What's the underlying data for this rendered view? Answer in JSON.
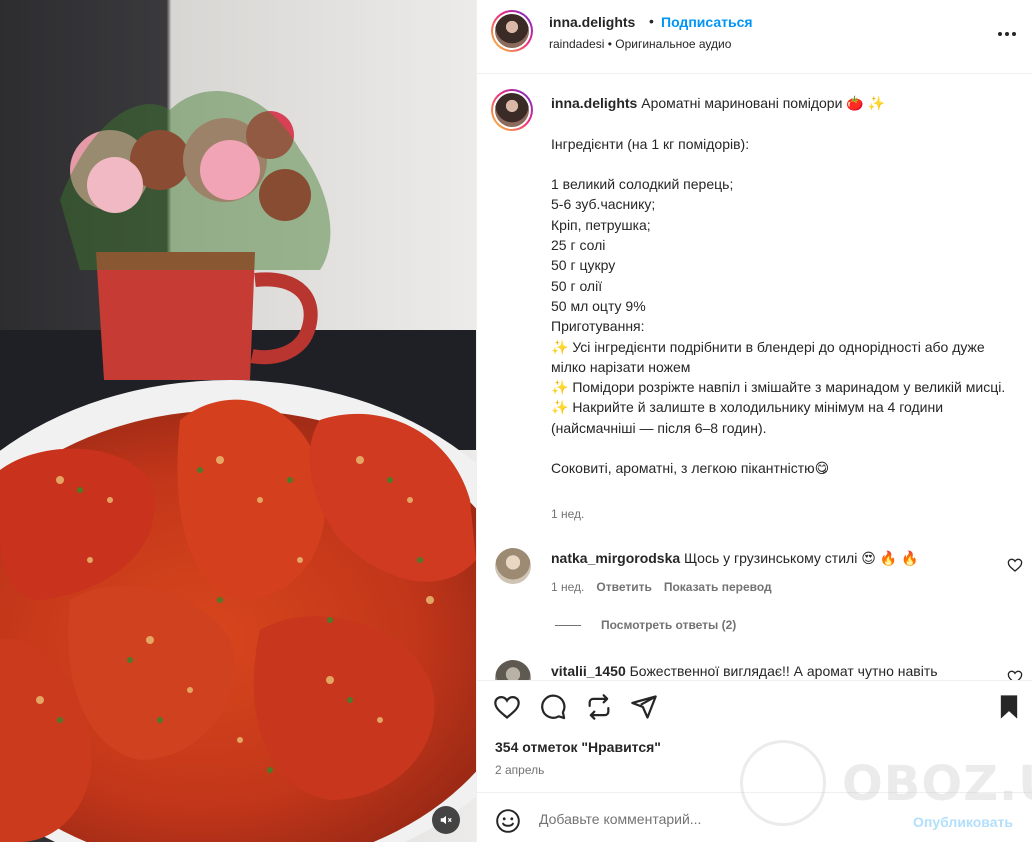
{
  "header": {
    "username": "inna.delights",
    "dot": "•",
    "follow_label": "Подписаться",
    "subtitle": "raindadesi • Оригинальное аудио"
  },
  "caption": {
    "username": "inna.delights",
    "text": " Ароматні мариновані помідори 🍅 ✨\n\nІнгредієнти (на 1 кг помідорів):\n\n1 великий солодкий перець;\n5-6 зуб.часнику;\nКріп, петрушка;\n25 г солі\n50 г цукру\n50 г олії\n50 мл оцту 9%\nПриготування:\n✨ Усі інгредієнти подрібнити в блендері до однорідності або дуже мілко нарізати ножем\n✨ Помідори розріжте навпіл і змішайте з маринадом у великій мисці.\n✨ Накрийте й залиште в холодильнику мінімум на 4 години (найсмачніші — після 6–8 годин).\n\nСоковиті, ароматні, з легкою пікантністю😋",
    "time": "1 нед."
  },
  "comment1": {
    "username": "natka_mirgorodska",
    "text": " Щось у грузинському стилі 😍 🔥 🔥",
    "time": "1 нед.",
    "reply_label": "Ответить",
    "translate_label": "Показать перевод",
    "view_replies": "Посмотреть ответы (2)"
  },
  "comment2": {
    "username": "vitalii_1450",
    "text": " Божественної виглядає!! А аромат чутно навіть"
  },
  "actions": {
    "likes": "354 отметок \"Нравится\"",
    "date": "2 апрель"
  },
  "composer": {
    "placeholder": "Добавьте комментарий...",
    "publish_label": "Опубликовать"
  },
  "watermark": {
    "text": "OBOZ.UA"
  },
  "colors": {
    "accent": "#0095f6",
    "publish_disabled": "#b2dffc"
  }
}
